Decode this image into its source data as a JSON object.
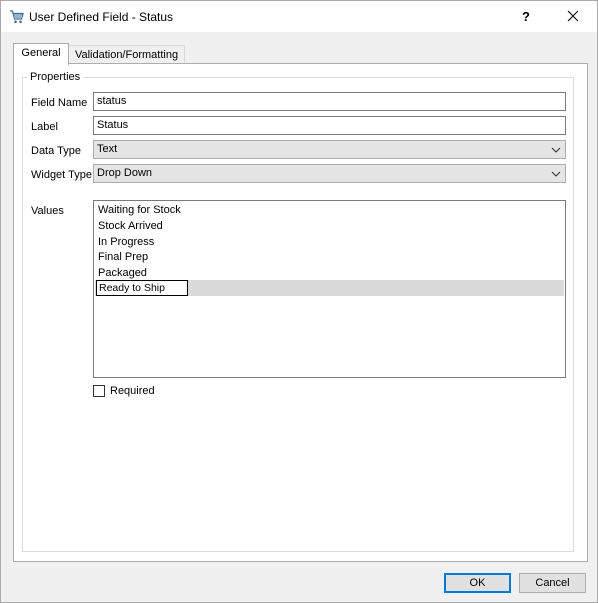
{
  "window": {
    "title": "User Defined Field - Status",
    "help_label": "?",
    "icon": "shopping-cart-icon"
  },
  "tabs": [
    {
      "label": "General",
      "active": true
    },
    {
      "label": "Validation/Formatting",
      "active": false
    }
  ],
  "properties": {
    "group_title": "Properties",
    "field_name": {
      "label": "Field Name",
      "value": "status"
    },
    "label": {
      "label": "Label",
      "value": "Status"
    },
    "data_type": {
      "label": "Data Type",
      "value": "Text"
    },
    "widget_type": {
      "label": "Widget Type",
      "value": "Drop Down"
    },
    "values": {
      "label": "Values",
      "items": [
        "Waiting for Stock",
        "Stock Arrived",
        "In Progress",
        "Final Prep",
        "Packaged"
      ],
      "editing_item": "Ready to Ship"
    },
    "required": {
      "label": "Required",
      "checked": false
    }
  },
  "buttons": {
    "ok": "OK",
    "cancel": "Cancel"
  },
  "colors": {
    "focus_border": "#0078d7",
    "selected_row": "#dadada"
  }
}
